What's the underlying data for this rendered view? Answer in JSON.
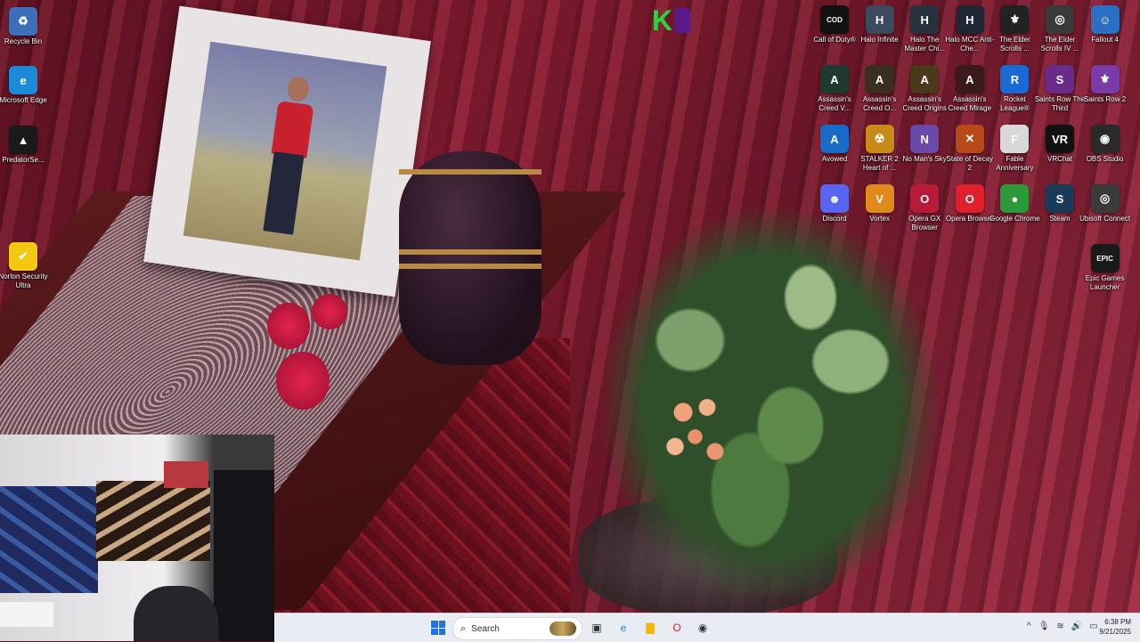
{
  "desktop": {
    "left_icons": [
      {
        "name": "recycle-bin",
        "label": "Recycle Bin",
        "glyph": "♻",
        "color": "#3d6fb8"
      },
      {
        "name": "microsoft-edge",
        "label": "Microsoft Edge",
        "glyph": "e",
        "color": "#1c8ad6"
      },
      {
        "name": "predatorsense",
        "label": "PredatorSe...",
        "glyph": "▲",
        "color": "#1a1a1a"
      },
      {
        "name": "norton-security-ultra",
        "label": "Norton Security Ultra",
        "glyph": "✔",
        "color": "#f2c811"
      }
    ],
    "right_icons": [
      {
        "name": "call-of-duty",
        "label": "Call of Duty®",
        "glyph": "COD",
        "color": "#111111"
      },
      {
        "name": "halo-infinite",
        "label": "Halo Infinite",
        "glyph": "H",
        "color": "#3b4a5c"
      },
      {
        "name": "halo-mcc",
        "label": "Halo The Master Chi...",
        "glyph": "H",
        "color": "#28323e"
      },
      {
        "name": "halo-mcc-anticheat",
        "label": "Halo MCC Anti-Che...",
        "glyph": "H",
        "color": "#1f2732"
      },
      {
        "name": "elder-scrolls-v",
        "label": "The Elder Scrolls ...",
        "glyph": "⚜",
        "color": "#222222"
      },
      {
        "name": "elder-scrolls-iv",
        "label": "The Elder Scrolls IV ...",
        "glyph": "◎",
        "color": "#3a3a3a"
      },
      {
        "name": "fallout-4",
        "label": "Fallout 4",
        "glyph": "☺",
        "color": "#2a6fc2"
      },
      {
        "name": "assassins-creed-v",
        "label": "Assassin's Creed V...",
        "glyph": "A",
        "color": "#1d3a30"
      },
      {
        "name": "assassins-creed-o",
        "label": "Assassin's Creed O...",
        "glyph": "A",
        "color": "#3a2e1e"
      },
      {
        "name": "assassins-creed-origins",
        "label": "Assassin's Creed Origins",
        "glyph": "A",
        "color": "#4a3a1a"
      },
      {
        "name": "assassins-creed-mirage",
        "label": "Assassin's Creed Mirage",
        "glyph": "A",
        "color": "#3a1a1a"
      },
      {
        "name": "rocket-league",
        "label": "Rocket League®",
        "glyph": "R",
        "color": "#1a6ad6"
      },
      {
        "name": "saints-row-the-third",
        "label": "Saints Row The Third",
        "glyph": "S",
        "color": "#6a2a8a"
      },
      {
        "name": "saints-row-2",
        "label": "Saints Row 2",
        "glyph": "⚜",
        "color": "#7a3aa8"
      },
      {
        "name": "avowed",
        "label": "Avowed",
        "glyph": "A",
        "color": "#1a6ac8"
      },
      {
        "name": "stalker-2",
        "label": "STALKER 2 Heart of ...",
        "glyph": "☢",
        "color": "#c88a1a"
      },
      {
        "name": "no-mans-sky",
        "label": "No Man's Sky",
        "glyph": "N",
        "color": "#6a4aa8"
      },
      {
        "name": "state-of-decay-2",
        "label": "State of Decay 2",
        "glyph": "✕",
        "color": "#b84a1a"
      },
      {
        "name": "fable-anniversary",
        "label": "Fable Anniversary",
        "glyph": "F",
        "color": "#d8d8d8"
      },
      {
        "name": "vrchat",
        "label": "VRChat",
        "glyph": "VR",
        "color": "#111111"
      },
      {
        "name": "obs-studio",
        "label": "OBS Studio",
        "glyph": "◉",
        "color": "#2a2a2a"
      },
      {
        "name": "discord",
        "label": "Discord",
        "glyph": "☻",
        "color": "#5865f2"
      },
      {
        "name": "vortex",
        "label": "Vortex",
        "glyph": "V",
        "color": "#e08a1a"
      },
      {
        "name": "opera-gx-browser",
        "label": "Opera GX Browser",
        "glyph": "O",
        "color": "#b81a3a"
      },
      {
        "name": "opera-browser",
        "label": "Opera Browser",
        "glyph": "O",
        "color": "#e0202a"
      },
      {
        "name": "google-chrome",
        "label": "Google Chrome",
        "glyph": "●",
        "color": "#2a9a3a"
      },
      {
        "name": "steam",
        "label": "Steam",
        "glyph": "S",
        "color": "#1a3a5a"
      },
      {
        "name": "ubisoft-connect",
        "label": "Ubisoft Connect",
        "glyph": "◎",
        "color": "#3a3a3a"
      },
      {
        "name": "epic-games-launcher",
        "label": "Epic Games Launcher",
        "glyph": "EPIC",
        "color": "#1a1a1a"
      }
    ]
  },
  "taskbar": {
    "search_placeholder": "Search",
    "search_icon": "search-icon",
    "apps": [
      {
        "name": "task-view",
        "glyph": "▣",
        "color": "#333333"
      },
      {
        "name": "microsoft-edge",
        "glyph": "e",
        "color": "#1c8ad6"
      },
      {
        "name": "file-explorer",
        "glyph": "▇",
        "color": "#f2b705"
      },
      {
        "name": "opera-gx",
        "glyph": "O",
        "color": "#e0202a"
      },
      {
        "name": "recorder-app",
        "glyph": "◉",
        "color": "#333333"
      }
    ],
    "tray": {
      "chevron": "^",
      "mic": "🎙",
      "wifi": "≋",
      "volume": "🔊",
      "battery": "▭"
    },
    "time": "6:38 PM",
    "date": "9/21/2025"
  }
}
